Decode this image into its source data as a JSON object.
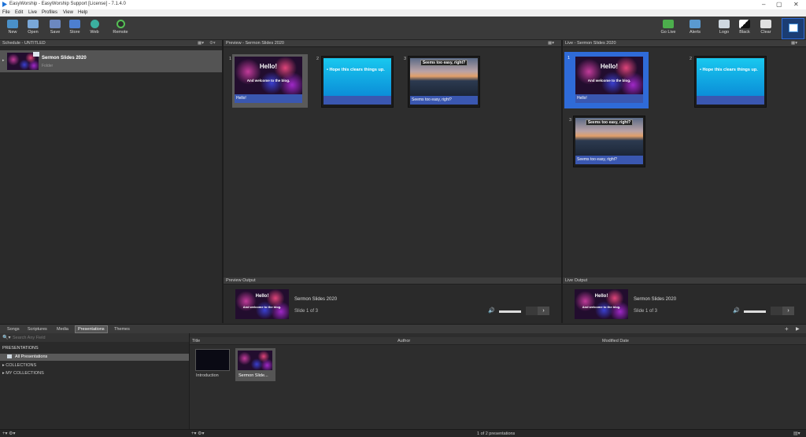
{
  "window": {
    "title": "EasyWorship - EasyWorship Support [License] - 7.1.4.0"
  },
  "menu": [
    "File",
    "Edit",
    "Live",
    "Profiles",
    "View",
    "Help"
  ],
  "toolbar": {
    "left": [
      {
        "label": "New",
        "icon": "new-icon"
      },
      {
        "label": "Open",
        "icon": "open-icon"
      },
      {
        "label": "Save",
        "icon": "save-icon"
      },
      {
        "label": "Store",
        "icon": "store-icon"
      },
      {
        "label": "Web",
        "icon": "web-icon"
      },
      {
        "label": "Remote",
        "icon": "remote-icon"
      }
    ],
    "right": [
      {
        "label": "Go Live",
        "icon": "go-live-icon"
      },
      {
        "label": "Alerts",
        "icon": "alerts-icon"
      },
      {
        "label": "Logo",
        "icon": "logo-icon"
      },
      {
        "label": "Black",
        "icon": "black-icon"
      },
      {
        "label": "Clear",
        "icon": "clear-icon"
      }
    ]
  },
  "schedule": {
    "header": "Schedule - UNTITLED",
    "item": {
      "title": "Sermon Slides 2020",
      "sub": "Folder"
    }
  },
  "preview": {
    "header": "Preview - Sermon Slides 2020",
    "slides": [
      {
        "num": "1",
        "title": "Hello!",
        "sub": "And welcome to the blog.",
        "caption": "Hello!"
      },
      {
        "num": "2",
        "bullet": "• Hope this clears things up.",
        "caption": ""
      },
      {
        "num": "3",
        "tbox": "Seems too easy, right?",
        "caption": "Seems too easy, right?"
      }
    ],
    "output": {
      "header": "Preview Output",
      "title": "Sermon Slides 2020",
      "slide": "Slide 1 of 3",
      "thumb_title": "Hello!",
      "thumb_sub": "And welcome to the blog."
    }
  },
  "live": {
    "header": "Live - Sermon Slides 2020",
    "slides": [
      {
        "num": "1",
        "title": "Hello!",
        "sub": "And welcome to the blog.",
        "caption": "Hello!"
      },
      {
        "num": "2",
        "bullet": "• Hope this clears things up.",
        "caption": ""
      },
      {
        "num": "3",
        "tbox": "Seems too easy, right?",
        "caption": "Seems too easy, right?"
      }
    ],
    "output": {
      "header": "Live Output",
      "title": "Sermon Slides 2020",
      "slide": "Slide 1 of 3",
      "thumb_title": "Hello!",
      "thumb_sub": "And welcome to the blog."
    }
  },
  "library": {
    "tabs": [
      "Songs",
      "Scriptures",
      "Media",
      "Presentations",
      "Themes"
    ],
    "active_tab": "Presentations",
    "search_placeholder": "Search Any Field",
    "tree": {
      "section": "PRESENTATIONS",
      "all": "All Presentations",
      "collections": "COLLECTIONS",
      "my_collections": "MY COLLECTIONS"
    },
    "columns": [
      "Title",
      "Author",
      "Modified Date"
    ],
    "items": [
      {
        "label": "Introduction"
      },
      {
        "label": "Sermon Slide..."
      }
    ],
    "status": "1 of 2 presentations"
  }
}
